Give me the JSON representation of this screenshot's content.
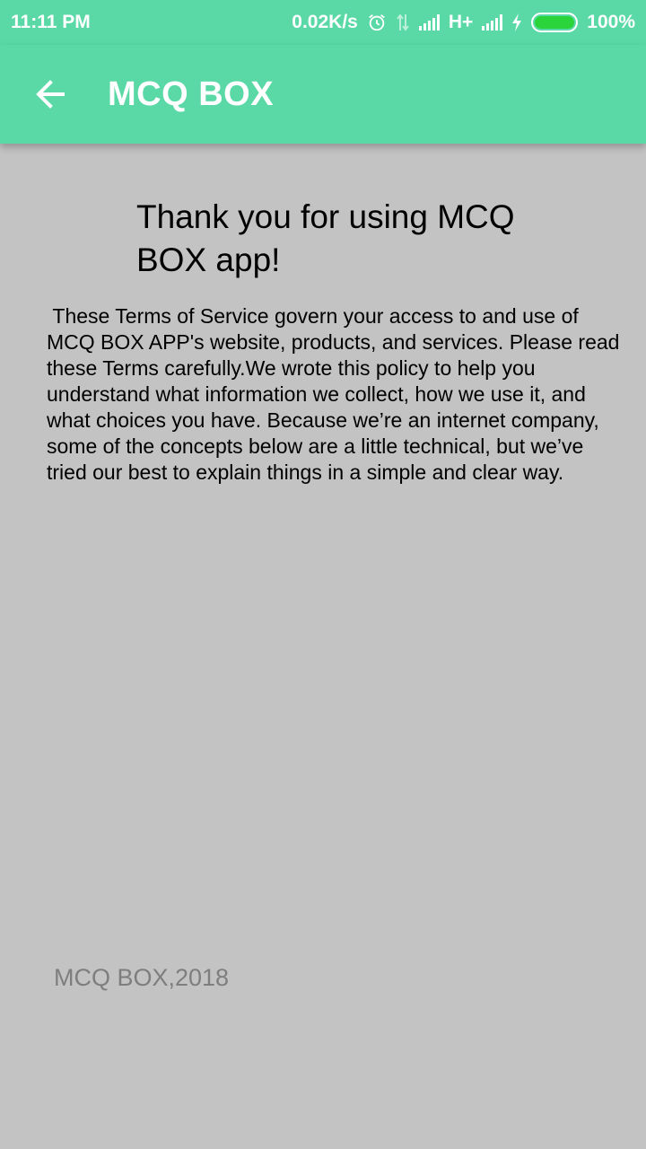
{
  "status_bar": {
    "time": "11:11 PM",
    "net_speed": "0.02K/s",
    "network_type": "H+",
    "battery_percent": "100%",
    "battery_level": 1.0,
    "icons": [
      "alarm-icon",
      "data-transfer-icon",
      "signal-icon",
      "charging-icon",
      "battery-icon"
    ]
  },
  "app_bar": {
    "title": "MCQ BOX",
    "back_icon": "arrow-left-icon",
    "color": "#5ad9a6"
  },
  "main": {
    "headline": "Thank you for using MCQ BOX app!",
    "body": " These Terms of Service govern your access to and use of MCQ BOX APP's website, products, and services. Please read these Terms carefully.We wrote this policy to help you understand what information we collect, how we use it, and what choices you have. Because we’re an internet company, some of the concepts below are a little technical, but we’ve tried our best to explain things in a simple and clear way.",
    "footer": "MCQ BOX,2018",
    "background": "#c3c3c3"
  }
}
